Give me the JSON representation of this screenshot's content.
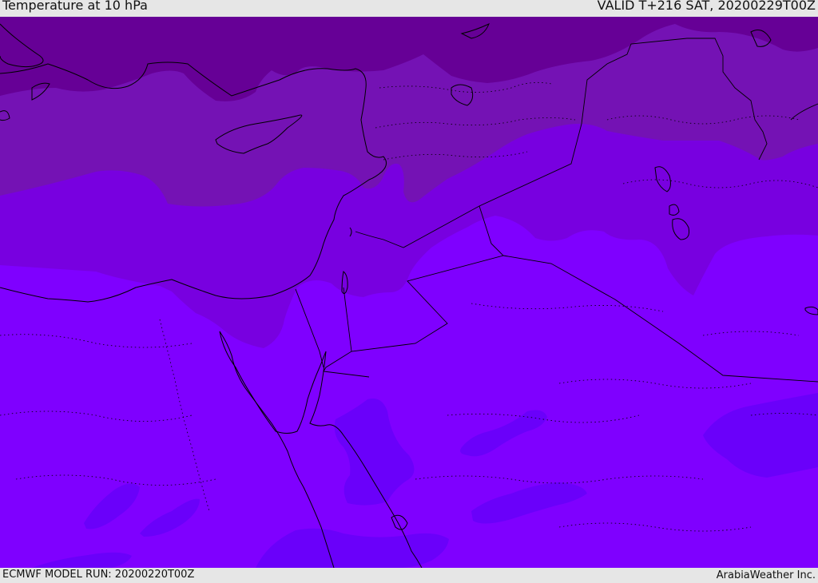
{
  "header": {
    "title": "Temperature at 10 hPa",
    "valid": "VALID T+216 SAT, 20200229T00Z"
  },
  "footer": {
    "model_run": "ECMWF MODEL RUN: 20200220T00Z",
    "credit": "ArabiaWeather Inc."
  },
  "map": {
    "region": "Eastern Mediterranean / Middle East",
    "colors": {
      "warmest_band": "#6a00fa",
      "base": "#7f00ff",
      "band_2": "#7800e0",
      "band_3": "#7412b4",
      "coldest_band": "#660096",
      "coastline": "#000000",
      "border": "#000000"
    }
  }
}
